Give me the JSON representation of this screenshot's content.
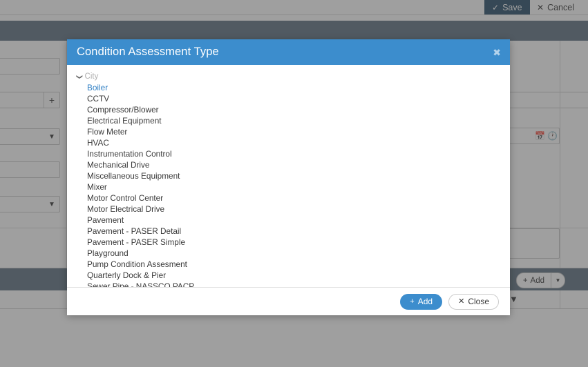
{
  "toolbar": {
    "save_label": "Save",
    "save_icon": "check-icon",
    "cancel_label": "Cancel",
    "cancel_icon": "close-icon"
  },
  "grid_toolbar": {
    "add_label": "Add",
    "add_icon": "plus-icon",
    "dropdown_icon": "caret-down-icon",
    "filter_icon": "funnel-icon"
  },
  "modal": {
    "title": "Condition Assessment Type",
    "close_icon": "close-icon",
    "header_color": "#3c8dcd",
    "group": {
      "label": "City",
      "expand_icon": "chevron-down-icon",
      "expanded": true
    },
    "items": [
      {
        "label": "Boiler",
        "selected": true
      },
      {
        "label": "CCTV",
        "selected": false
      },
      {
        "label": "Compressor/Blower",
        "selected": false
      },
      {
        "label": "Electrical Equipment",
        "selected": false
      },
      {
        "label": "Flow Meter",
        "selected": false
      },
      {
        "label": "HVAC",
        "selected": false
      },
      {
        "label": "Instrumentation Control",
        "selected": false
      },
      {
        "label": "Mechanical Drive",
        "selected": false
      },
      {
        "label": "Miscellaneous Equipment",
        "selected": false
      },
      {
        "label": "Mixer",
        "selected": false
      },
      {
        "label": "Motor Control Center",
        "selected": false
      },
      {
        "label": "Motor Electrical Drive",
        "selected": false
      },
      {
        "label": "Pavement",
        "selected": false
      },
      {
        "label": "Pavement - PASER Detail",
        "selected": false
      },
      {
        "label": "Pavement - PASER Simple",
        "selected": false
      },
      {
        "label": "Playground",
        "selected": false
      },
      {
        "label": "Pump Condition Assesment",
        "selected": false
      },
      {
        "label": "Quarterly Dock & Pier",
        "selected": false
      },
      {
        "label": "Sewer Pipe - NASSCO PACP",
        "selected": false
      }
    ],
    "footer": {
      "add_label": "Add",
      "add_icon": "plus-icon",
      "close_label": "Close",
      "close_icon": "close-icon",
      "add_color": "#3c8dcd"
    }
  },
  "background_form": {
    "add_row_icon": "plus-icon",
    "dropdown_icon": "caret-down-icon",
    "calendar_icon": "calendar-icon",
    "clock_icon": "clock-icon"
  }
}
